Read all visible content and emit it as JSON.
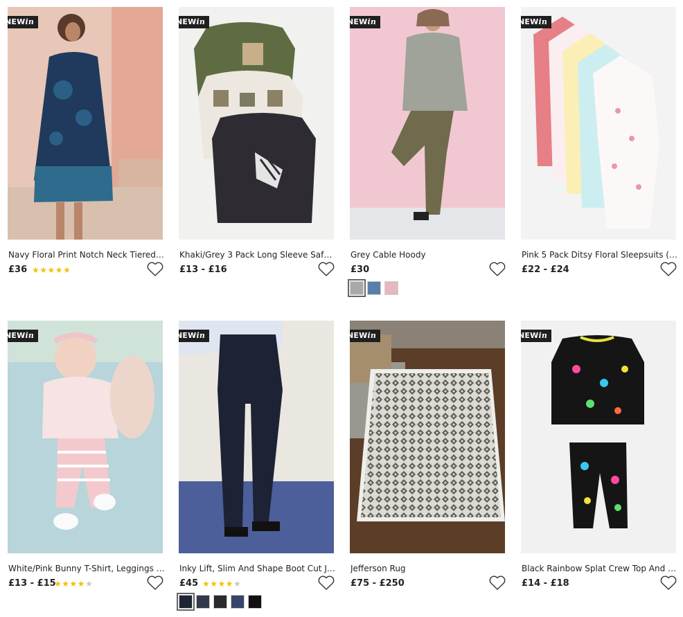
{
  "badge": {
    "new": "NEW",
    "in": "in"
  },
  "products": [
    {
      "title": "Navy Floral Print Notch Neck Tiered Mi...",
      "price": "£36",
      "rating": 5,
      "swatches": []
    },
    {
      "title": "Khaki/Grey 3 Pack Long Sleeve Safari T...",
      "price": "£13 - £16",
      "rating": null,
      "swatches": []
    },
    {
      "title": "Grey Cable Hoody",
      "price": "£30",
      "rating": null,
      "swatches": [
        "#a8aba4",
        "#5b7fa8",
        "#e8b6bd"
      ]
    },
    {
      "title": "Pink 5 Pack Ditsy Floral Sleepsuits (0m...",
      "price": "£22 - £24",
      "rating": null,
      "swatches": []
    },
    {
      "title": "White/Pink Bunny T-Shirt, Leggings A...",
      "price": "£13 - £15",
      "rating": 4,
      "swatches": []
    },
    {
      "title": "Inky Lift, Slim And Shape Boot Cut Jeans",
      "price": "£45",
      "rating": 3.5,
      "swatches": [
        "#1f2433",
        "#33384a",
        "#2a2a2c",
        "#37456a",
        "#111111"
      ]
    },
    {
      "title": "Jefferson Rug",
      "price": "£75 - £250",
      "rating": null,
      "swatches": []
    },
    {
      "title": "Black Rainbow Splat Crew Top And Jog...",
      "price": "£14 - £18",
      "rating": null,
      "swatches": []
    }
  ]
}
